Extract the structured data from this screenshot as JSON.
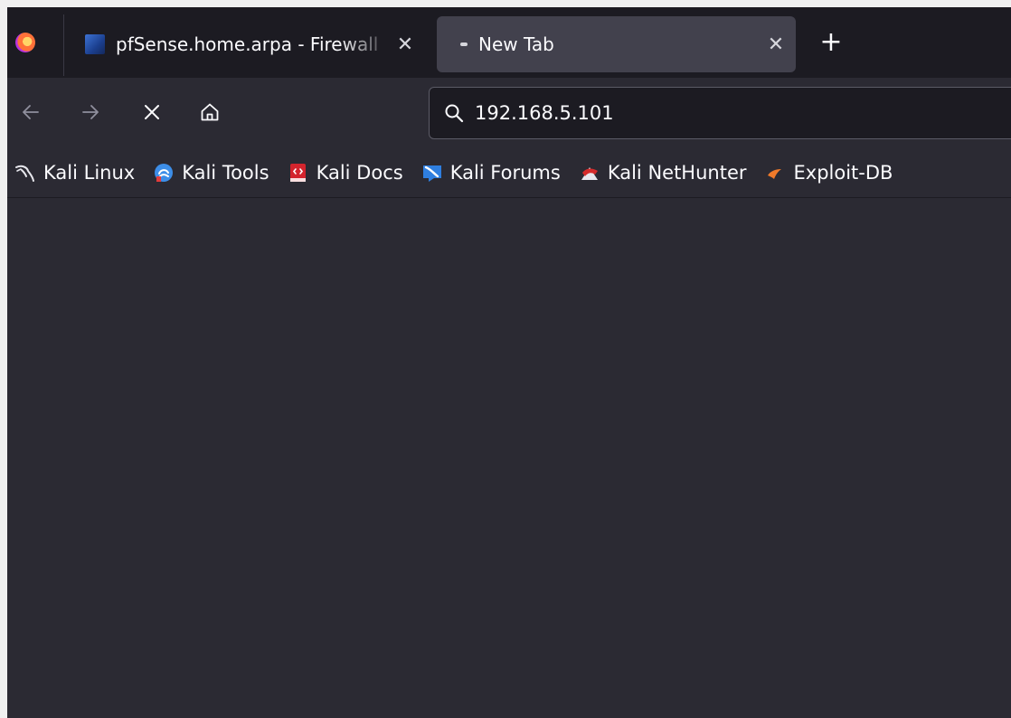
{
  "tabs": [
    {
      "title": "pfSense.home.arpa - Firewall",
      "favicon": "pfsense-favicon",
      "active": false,
      "close_glyph": "✕"
    },
    {
      "title": "New Tab",
      "favicon": "newtab-dot",
      "active": true,
      "close_glyph": "✕"
    }
  ],
  "new_tab_glyph": "+",
  "navbar": {
    "url_value": "192.168.5.101",
    "icons": [
      "arrow-left-icon",
      "arrow-right-icon",
      "stop-icon",
      "home-icon",
      "search-icon"
    ]
  },
  "bookmarks": [
    {
      "label": "Kali Linux",
      "icon": "kali-dragon-icon"
    },
    {
      "label": "Kali Tools",
      "icon": "kali-tools-icon"
    },
    {
      "label": "Kali Docs",
      "icon": "kali-docs-icon"
    },
    {
      "label": "Kali Forums",
      "icon": "kali-forums-icon"
    },
    {
      "label": "Kali NetHunter",
      "icon": "kali-nethunter-icon"
    },
    {
      "label": "Exploit-DB",
      "icon": "exploit-db-icon"
    }
  ],
  "colors": {
    "tab_strip": "#1c1b22",
    "toolbar": "#2b2a33",
    "active_tab": "#42414d",
    "text": "#fbfbfe"
  }
}
